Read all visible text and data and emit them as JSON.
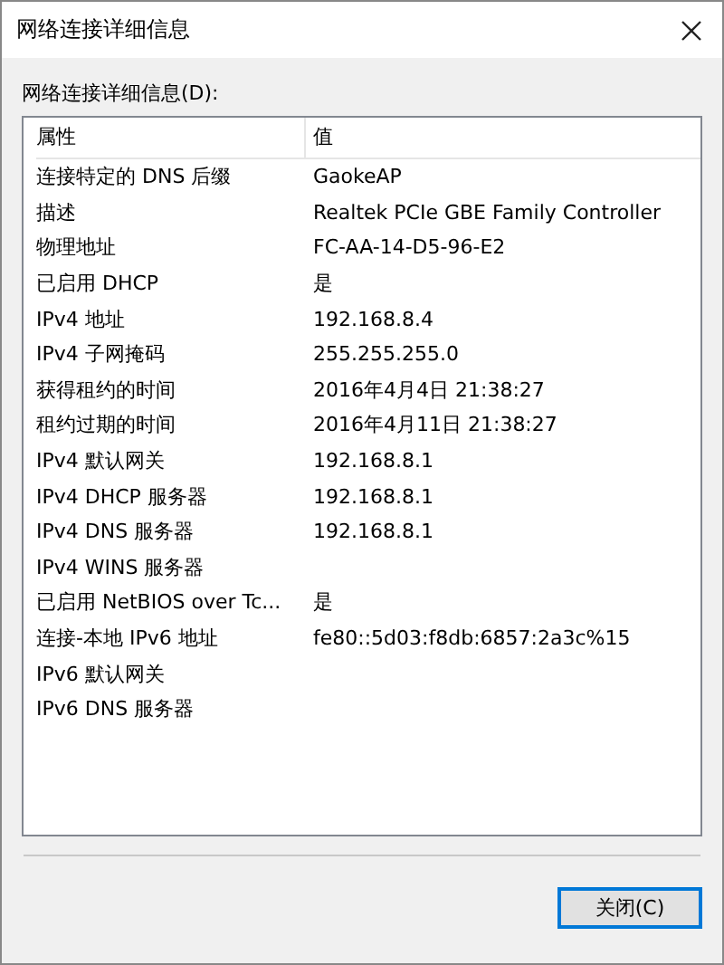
{
  "window": {
    "title": "网络连接详细信息"
  },
  "list_label": "网络连接详细信息(D):",
  "table": {
    "columns": [
      "属性",
      "值"
    ],
    "rows": [
      {
        "property": "连接特定的 DNS 后缀",
        "value": "GaokeAP"
      },
      {
        "property": "描述",
        "value": "Realtek PCIe GBE Family Controller"
      },
      {
        "property": "物理地址",
        "value": "FC-AA-14-D5-96-E2"
      },
      {
        "property": "已启用 DHCP",
        "value": "是"
      },
      {
        "property": "IPv4 地址",
        "value": "192.168.8.4"
      },
      {
        "property": "IPv4 子网掩码",
        "value": "255.255.255.0"
      },
      {
        "property": "获得租约的时间",
        "value": "2016年4月4日 21:38:27"
      },
      {
        "property": "租约过期的时间",
        "value": "2016年4月11日 21:38:27"
      },
      {
        "property": "IPv4 默认网关",
        "value": "192.168.8.1"
      },
      {
        "property": "IPv4 DHCP 服务器",
        "value": "192.168.8.1"
      },
      {
        "property": "IPv4 DNS 服务器",
        "value": "192.168.8.1"
      },
      {
        "property": "IPv4 WINS 服务器"
      },
      {
        "property": "已启用 NetBIOS over Tc...",
        "value": "是"
      },
      {
        "property": "连接-本地 IPv6 地址",
        "value": "fe80::5d03:f8db:6857:2a3c%15"
      },
      {
        "property": "IPv6 默认网关"
      },
      {
        "property": "IPv6 DNS 服务器"
      }
    ]
  },
  "buttons": [
    {
      "label": "关闭(C)",
      "default": true
    }
  ]
}
